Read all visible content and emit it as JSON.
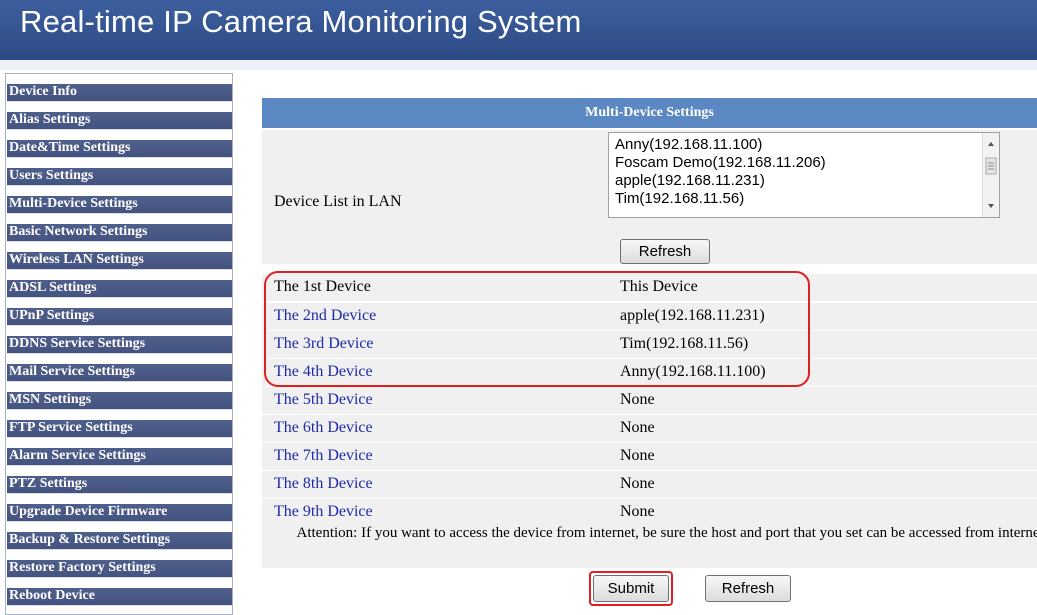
{
  "header": {
    "title": "Real-time IP Camera Monitoring System"
  },
  "sidebar": {
    "items": [
      "Device Info",
      "Alias Settings",
      "Date&Time Settings",
      "Users Settings",
      "Multi-Device Settings",
      "Basic Network Settings",
      "Wireless LAN Settings",
      "ADSL Settings",
      "UPnP Settings",
      "DDNS Service Settings",
      "Mail Service Settings",
      "MSN Settings",
      "FTP Service Settings",
      "Alarm Service Settings",
      "PTZ Settings",
      "Upgrade Device Firmware",
      "Backup & Restore Settings",
      "Restore Factory Settings",
      "Reboot Device"
    ]
  },
  "panel": {
    "title": "Multi-Device Settings",
    "lan_label": "Device List in LAN",
    "lan_devices": [
      "Anny(192.168.11.100)",
      "Foscam Demo(192.168.11.206)",
      "apple(192.168.11.231)",
      "Tim(192.168.11.56)"
    ],
    "refresh_label": "Refresh",
    "devices": [
      {
        "label": "The 1st Device",
        "value": "This Device"
      },
      {
        "label": "The 2nd Device",
        "value": "apple(192.168.11.231)"
      },
      {
        "label": "The 3rd Device",
        "value": "Tim(192.168.11.56)"
      },
      {
        "label": "The 4th Device",
        "value": "Anny(192.168.11.100)"
      },
      {
        "label": "The 5th Device",
        "value": "None"
      },
      {
        "label": "The 6th Device",
        "value": "None"
      },
      {
        "label": "The 7th Device",
        "value": "None"
      },
      {
        "label": "The 8th Device",
        "value": "None"
      },
      {
        "label": "The 9th Device",
        "value": "None"
      }
    ],
    "attention": "Attention: If you want to access the device from internet, be sure the host and port that you set can be accessed from internet.",
    "submit_label": "Submit",
    "refresh2_label": "Refresh"
  },
  "colors": {
    "header": "#2c4a85",
    "nav": "#4a5a87",
    "panel_head": "#5b88c2",
    "link": "#1f2aa9",
    "highlight": "#e02020"
  }
}
